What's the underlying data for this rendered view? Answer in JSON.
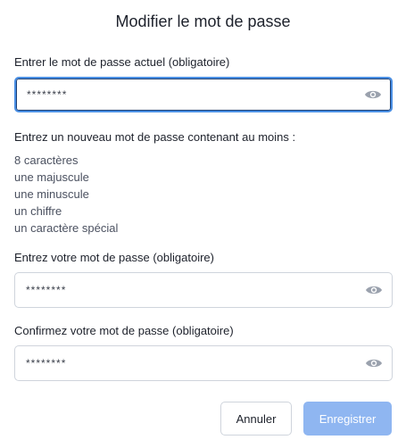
{
  "dialog": {
    "title": "Modifier le mot de passe"
  },
  "current_password": {
    "label": "Entrer le mot de passe actuel (obligatoire)",
    "value": "********"
  },
  "requirements": {
    "intro": "Entrez un nouveau mot de passe contenant au moins :",
    "items": [
      "8 caractères",
      "une majuscule",
      "une minuscule",
      "un chiffre",
      "un caractère spécial"
    ]
  },
  "new_password": {
    "label": "Entrez votre mot de passe (obligatoire)",
    "value": "********"
  },
  "confirm_password": {
    "label": "Confirmez votre mot de passe (obligatoire)",
    "value": "********"
  },
  "buttons": {
    "cancel": "Annuler",
    "save": "Enregistrer"
  },
  "icons": {
    "toggle_visibility": "eye-icon"
  },
  "colors": {
    "accent": "#4a8fe4",
    "save_button_disabled": "#8fb6f1",
    "icon": "#9aa1ad"
  }
}
